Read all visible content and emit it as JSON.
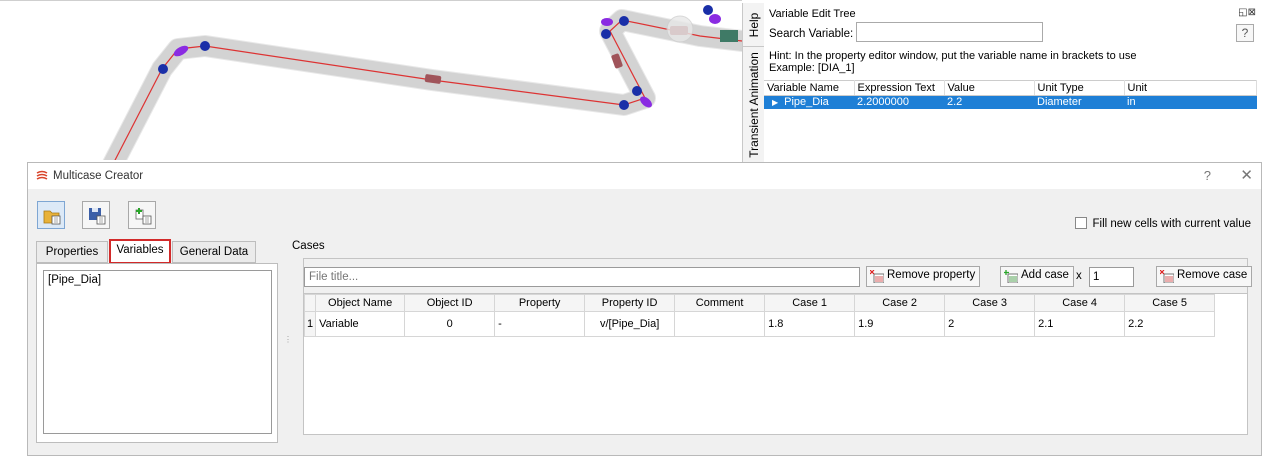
{
  "side_tabs": {
    "help": "Help",
    "transient_animation": "Transient Animation"
  },
  "variable_tree": {
    "title": "Variable Edit Tree",
    "search_label": "Search Variable:",
    "search_value": "",
    "help_button": "?",
    "hint_line1": "Hint: In the property editor window, put the variable name in brackets to use",
    "hint_line2": "Example: [DIA_1]",
    "columns": [
      "Variable Name",
      "Expression Text",
      "Value",
      "Unit Type",
      "Unit"
    ],
    "rows": [
      {
        "name": "Pipe_Dia",
        "expression": "2.2000000",
        "value": "2.2",
        "unit_type": "Diameter",
        "unit": "in"
      }
    ]
  },
  "dialog": {
    "title": "Multicase Creator",
    "help_glyph": "?",
    "close_glyph": "✕",
    "fill_new_cells_label": "Fill new cells with current value",
    "tabs": [
      "Properties",
      "Variables",
      "General Data"
    ],
    "active_tab": "Variables",
    "variables_list": [
      "[Pipe_Dia]"
    ],
    "cases_label": "Cases",
    "file_title_placeholder": "File title...",
    "remove_property_label": "Remove property",
    "add_case_label": "Add case",
    "x_label": "x",
    "add_case_count": "1",
    "remove_case_label": "Remove case",
    "grid_columns": [
      "Object Name",
      "Object ID",
      "Property",
      "Property ID",
      "Comment",
      "Case 1",
      "Case 2",
      "Case 3",
      "Case 4",
      "Case 5"
    ],
    "grid_rows": [
      {
        "row_num": "1",
        "object_name": "Variable",
        "object_id": "0",
        "property": "-",
        "property_id": "v/[Pipe_Dia]",
        "comment": "",
        "cases": [
          "1.8",
          "1.9",
          "2",
          "2.1",
          "2.2"
        ]
      }
    ]
  },
  "colors": {
    "selection": "#1e7fd6",
    "active_tab_border": "#d22a2a",
    "pipe_node": "#1a2fa8",
    "pipe_fitting": "#8a2be2"
  }
}
